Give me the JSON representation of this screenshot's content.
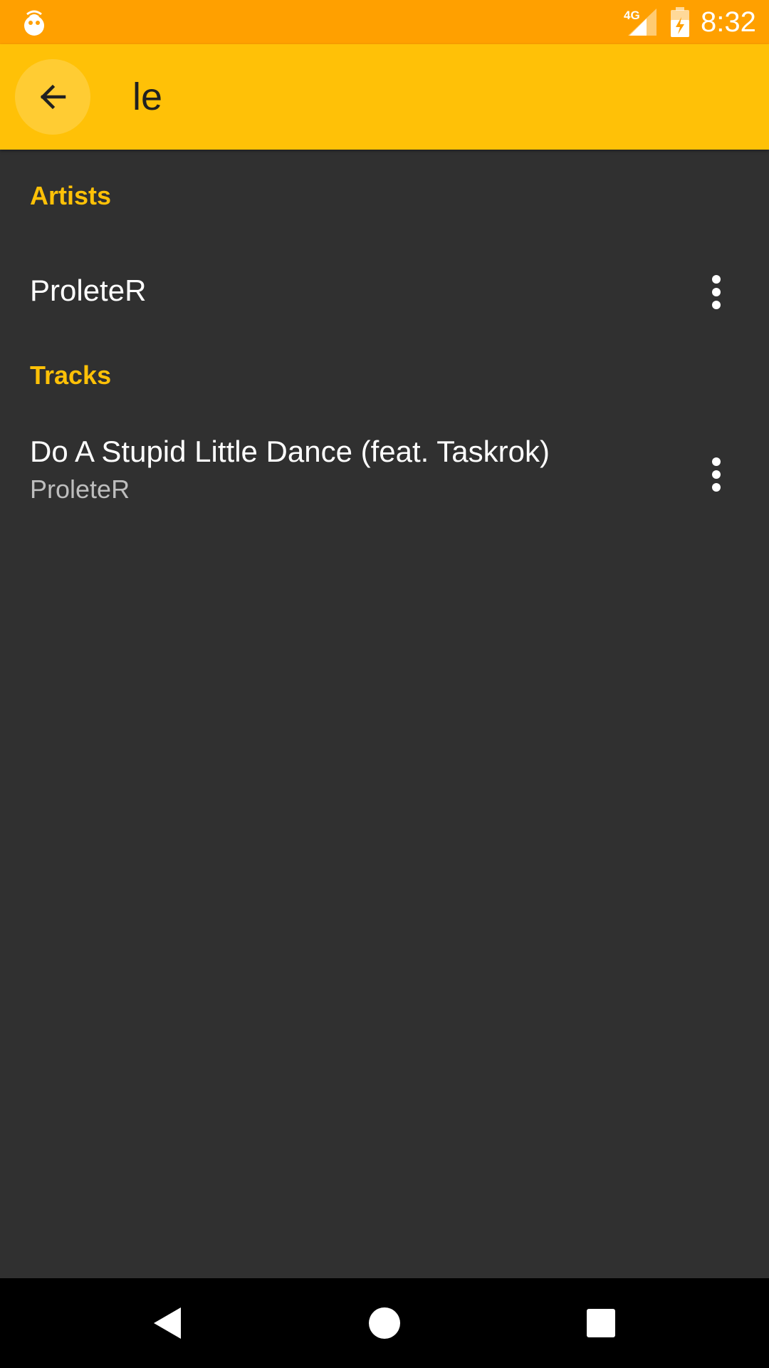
{
  "status_bar": {
    "network_label": "4G",
    "time": "8:32",
    "background_color": "#FFA000",
    "icons": [
      "app-notification-icon",
      "signal-icon",
      "battery-charging-icon"
    ]
  },
  "toolbar": {
    "background_color": "#FFC107",
    "back_icon": "arrow-left-icon",
    "search_value": "le"
  },
  "results": {
    "background_color": "#303030",
    "accent_color": "#FFC107",
    "sections": [
      {
        "header": "Artists",
        "items": [
          {
            "title": "ProleteR",
            "menu_icon": "more-vert-icon"
          }
        ]
      },
      {
        "header": "Tracks",
        "items": [
          {
            "title": "Do A Stupid Little Dance (feat. Taskrok)",
            "subtitle": "ProleteR",
            "menu_icon": "more-vert-icon"
          }
        ]
      }
    ]
  },
  "nav_bar": {
    "buttons": [
      "back-triangle-icon",
      "home-circle-icon",
      "recents-square-icon"
    ]
  }
}
